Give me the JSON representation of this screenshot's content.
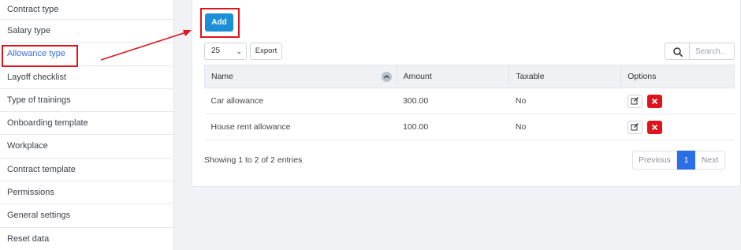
{
  "sidebar": {
    "items": [
      {
        "label": "Contract type"
      },
      {
        "label": "Salary type"
      },
      {
        "label": "Allowance type"
      },
      {
        "label": "Layoff checklist"
      },
      {
        "label": "Type of trainings"
      },
      {
        "label": "Onboarding template"
      },
      {
        "label": "Workplace"
      },
      {
        "label": "Contract template"
      },
      {
        "label": "Permissions"
      },
      {
        "label": "General settings"
      },
      {
        "label": "Reset data"
      }
    ],
    "active_index": 2
  },
  "toolbar": {
    "add_label": "Add",
    "page_size": "25",
    "export_label": "Export",
    "search_placeholder": "Search.."
  },
  "table": {
    "columns": [
      "Name",
      "Amount",
      "Taxable",
      "Options"
    ],
    "rows": [
      {
        "name": "Car allowance",
        "amount": "300.00",
        "taxable": "No"
      },
      {
        "name": "House rent allowance",
        "amount": "100.00",
        "taxable": "No"
      }
    ]
  },
  "footer": {
    "info": "Showing 1 to 2 of 2 entries",
    "prev_label": "Previous",
    "current_page": "1",
    "next_label": "Next"
  },
  "colors": {
    "accent": "#1c8fd6",
    "active_link": "#3a6fd8",
    "highlight": "#e0141b",
    "delete": "#e0121b",
    "page_active": "#2a6fe6"
  }
}
